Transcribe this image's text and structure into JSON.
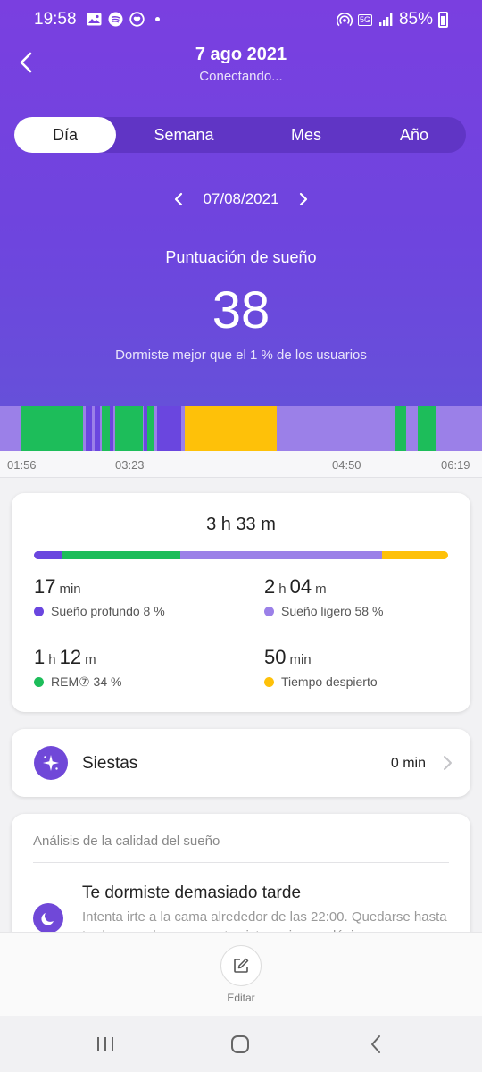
{
  "status_bar": {
    "time": "19:58",
    "battery": "85%",
    "network": "5G"
  },
  "header": {
    "title": "7 ago 2021",
    "subtitle": "Conectando..."
  },
  "tabs": [
    {
      "label": "Día",
      "active": true
    },
    {
      "label": "Semana",
      "active": false
    },
    {
      "label": "Mes",
      "active": false
    },
    {
      "label": "Año",
      "active": false
    }
  ],
  "date_nav": {
    "date": "07/08/2021"
  },
  "score": {
    "label": "Puntuación de sueño",
    "value": "38",
    "description": "Dormiste mejor que el 1 % de los usuarios"
  },
  "timeline": {
    "labels": [
      "01:56",
      "03:23",
      "04:50",
      "06:19"
    ],
    "segments": [
      {
        "stage": "rem",
        "start": 0.044,
        "end": 0.172
      },
      {
        "stage": "deep",
        "start": 0.178,
        "end": 0.19
      },
      {
        "stage": "deep",
        "start": 0.196,
        "end": 0.207
      },
      {
        "stage": "rem",
        "start": 0.212,
        "end": 0.227
      },
      {
        "stage": "deep",
        "start": 0.228,
        "end": 0.236
      },
      {
        "stage": "rem",
        "start": 0.238,
        "end": 0.297
      },
      {
        "stage": "deep",
        "start": 0.298,
        "end": 0.306
      },
      {
        "stage": "rem",
        "start": 0.306,
        "end": 0.318
      },
      {
        "stage": "deep",
        "start": 0.326,
        "end": 0.376
      },
      {
        "stage": "awake",
        "start": 0.383,
        "end": 0.574
      },
      {
        "stage": "rem",
        "start": 0.818,
        "end": 0.843
      },
      {
        "stage": "rem",
        "start": 0.867,
        "end": 0.906
      }
    ]
  },
  "colors": {
    "deep": "#6a46df",
    "light": "#9b80e8",
    "rem": "#1dbd5a",
    "awake": "#fec109",
    "accent": "#7048d8"
  },
  "summary": {
    "total": "3 h 33 m",
    "bar": [
      {
        "stage": "deep",
        "percent": 8
      },
      {
        "stage": "rem",
        "percent": 34
      },
      {
        "stage": "light",
        "percent": 58
      },
      {
        "stage": "awake",
        "percent": 19
      }
    ],
    "stats": {
      "deep": {
        "v1": "17",
        "u1": "min",
        "label": "Sueño profundo 8 %"
      },
      "light": {
        "v1": "2",
        "u1": "h",
        "v2": "04",
        "u2": "m",
        "label": "Sueño ligero 58 %"
      },
      "rem": {
        "v1": "1",
        "u1": "h",
        "v2": "12",
        "u2": "m",
        "label": "REM⑦ 34 %"
      },
      "awake": {
        "v1": "50",
        "u1": "min",
        "label": "Tiempo despierto"
      }
    }
  },
  "naps": {
    "label": "Siestas",
    "value": "0 min",
    "icon": "sparkle-icon"
  },
  "analysis": {
    "title": "Análisis de la calidad del sueño",
    "heading": "Te dormiste demasiado tarde",
    "text": "Intenta irte a la cama alrededor de las 22:00. Quedarse hasta tarde no es bueno para tu sistema inmunológico y",
    "icon": "moon-icon"
  },
  "bottom": {
    "edit_label": "Editar"
  }
}
